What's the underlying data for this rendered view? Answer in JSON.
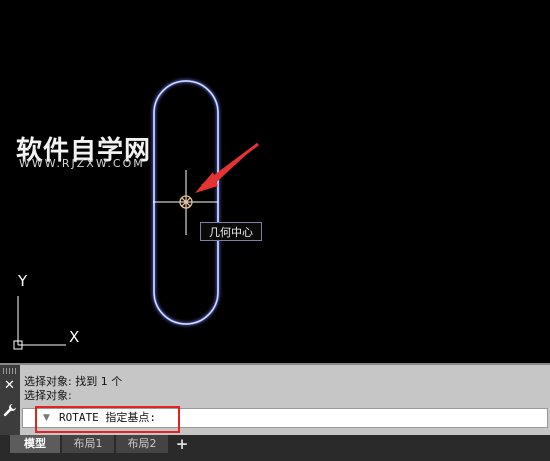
{
  "watermark": {
    "title": "软件自学网",
    "url": "WWW.RJZXW.COM"
  },
  "tooltip": {
    "label": "几何中心"
  },
  "ucs": {
    "x_label": "X",
    "y_label": "Y"
  },
  "command_panel": {
    "close_icon": "close-icon",
    "history": [
      "选择对象: 找到 1 个",
      "选择对象:"
    ],
    "prompt_text": "ROTATE 指定基点:"
  },
  "tabs": {
    "model": "模型",
    "layout1": "布局1",
    "layout2": "布局2",
    "add": "+"
  },
  "colors": {
    "canvas_background": "#000000",
    "slot_outline": "#7f8fff",
    "crosshair": "#ffffff",
    "center_marker": "#e8c49a",
    "annotation_arrow": "#e53333",
    "highlight_box": "#e42222"
  }
}
